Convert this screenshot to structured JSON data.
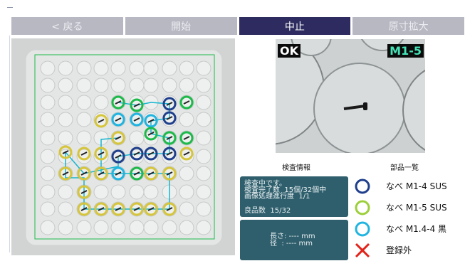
{
  "tabs": [
    {
      "label": "< 戻る",
      "active": false
    },
    {
      "label": "開始",
      "active": false
    },
    {
      "label": "中止",
      "active": true
    },
    {
      "label": "原寸拡大",
      "active": false
    }
  ],
  "camera": {
    "result_badge": "OK",
    "part_badge": "M1-5"
  },
  "section_labels": {
    "inspection": "検査情報",
    "parts": "部品一覧"
  },
  "inspection_panel": {
    "status": "検査中です。",
    "count": "検査完了数  15個/32個中",
    "progress": "画像処理進行度  1/1",
    "good": "良品数  15/32"
  },
  "measure_panel": {
    "length": "長さ: ---- mm",
    "diameter": "径  : ---- mm"
  },
  "parts_legend": [
    {
      "label": "なべ M1-4 SUS",
      "icon": "circle",
      "color": "#1f3f8c"
    },
    {
      "label": "なべ M1-5 SUS",
      "icon": "circle",
      "color": "#9ccf3a"
    },
    {
      "label": "なべ M1.4-4 黒",
      "icon": "circle",
      "color": "#20b4e0"
    },
    {
      "label": "登録外",
      "icon": "cross",
      "color": "#e2231a"
    }
  ],
  "colors": {
    "accent": "#2d2b5f",
    "panel": "#2f5f6d",
    "path": "#17b6cf"
  }
}
